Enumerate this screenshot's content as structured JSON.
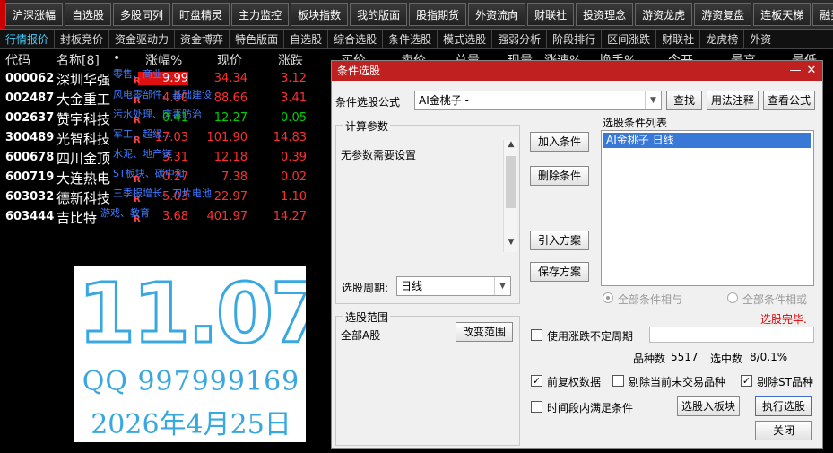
{
  "top_buttons": [
    "沪深涨幅",
    "自选股",
    "多股同列",
    "盯盘精灵",
    "主力监控",
    "板块指数",
    "我的版面",
    "股指期货",
    "外资流向",
    "财联社",
    "投资理念",
    "游资龙虎",
    "游资复盘",
    "连板天梯",
    "融买卖"
  ],
  "tabs": [
    "行情报价",
    "封板竞价",
    "资金驱动力",
    "资金博弈",
    "特色版面",
    "自选股",
    "综合选股",
    "条件选股",
    "模式选股",
    "强弱分析",
    "阶段排行",
    "区间涨跌",
    "财联社",
    "龙虎榜",
    "外资"
  ],
  "columns": [
    "代码",
    "名称[8]",
    "•",
    "涨幅%",
    "现价",
    "涨跌",
    "买价",
    "卖价",
    "总量",
    "现量",
    "涨速%",
    "换手%",
    "今开",
    "最高",
    "最低"
  ],
  "stocks": [
    {
      "code": "000062",
      "name": "深圳华强",
      "pct": "9.99",
      "price": "34.34",
      "chg": "3.12",
      "tag": "零售、商业..."
    },
    {
      "code": "002487",
      "name": "大金重工",
      "pct": "4.00",
      "price": "88.66",
      "chg": "3.41",
      "tag": "风电零部件、基础建设"
    },
    {
      "code": "002637",
      "name": "赞宇科技",
      "pct": "-0.41",
      "price": "12.27",
      "chg": "-0.05",
      "tag": "污水处理、废毒防治"
    },
    {
      "code": "300489",
      "name": "光智科技",
      "pct": "17.03",
      "price": "101.90",
      "chg": "14.83",
      "tag": "军工、超级..."
    },
    {
      "code": "600678",
      "name": "四川金顶",
      "pct": "3.31",
      "price": "12.18",
      "chg": "0.39",
      "tag": "水泥、地产链"
    },
    {
      "code": "600719",
      "name": "大连热电",
      "pct": "0.27",
      "price": "7.38",
      "chg": "0.02",
      "tag": "ST板块、碳中和"
    },
    {
      "code": "603032",
      "name": "德新科技",
      "pct": "5.03",
      "price": "22.97",
      "chg": "1.10",
      "tag": "三季报增长、刀片电池"
    },
    {
      "code": "603444",
      "name": "吉比特",
      "pct": "3.68",
      "price": "401.97",
      "chg": "14.27",
      "tag": "游戏、教育"
    }
  ],
  "watermark": {
    "big": "11.07",
    "qq": "QQ 997999169",
    "date": "2026年4月25日"
  },
  "dialog": {
    "title": "条件选股",
    "formula_label": "条件选股公式",
    "formula_value": "AI金桃子  -",
    "find_btn": "查找",
    "usage_btn": "用法注释",
    "view_btn": "查看公式",
    "calc_group": "计算参数",
    "calc_text": "无参数需要设置",
    "period_label": "选股周期:",
    "period_value": "日线",
    "add_btn": "加入条件",
    "del_btn": "删除条件",
    "import_btn": "引入方案",
    "save_btn": "保存方案",
    "list_title": "选股条件列表",
    "list_items": [
      "AI金桃子  日线"
    ],
    "radio_and": "全部条件相与",
    "radio_or": "全部条件相或",
    "status": "选股完毕.",
    "range_group": "选股范围",
    "range_value": "全部A股",
    "change_range_btn": "改变范围",
    "uncertain_label": "使用涨跌不定周期",
    "count_label": "品种数",
    "count_value": "5517",
    "selected_label": "选中数",
    "selected_value": "8/0.1%",
    "chk_prefq": "前复权数据",
    "chk_remove_notrade": "剔除当前未交易品种",
    "chk_remove_st": "剔除ST品种",
    "chk_period_satisfy": "时间段内满足条件",
    "to_block_btn": "选股入板块",
    "exec_btn": "执行选股",
    "close_btn": "关闭",
    "colors": {
      "title_bar": "#c02020",
      "list_selected": "#3a78d8",
      "status": "#e00000"
    }
  }
}
